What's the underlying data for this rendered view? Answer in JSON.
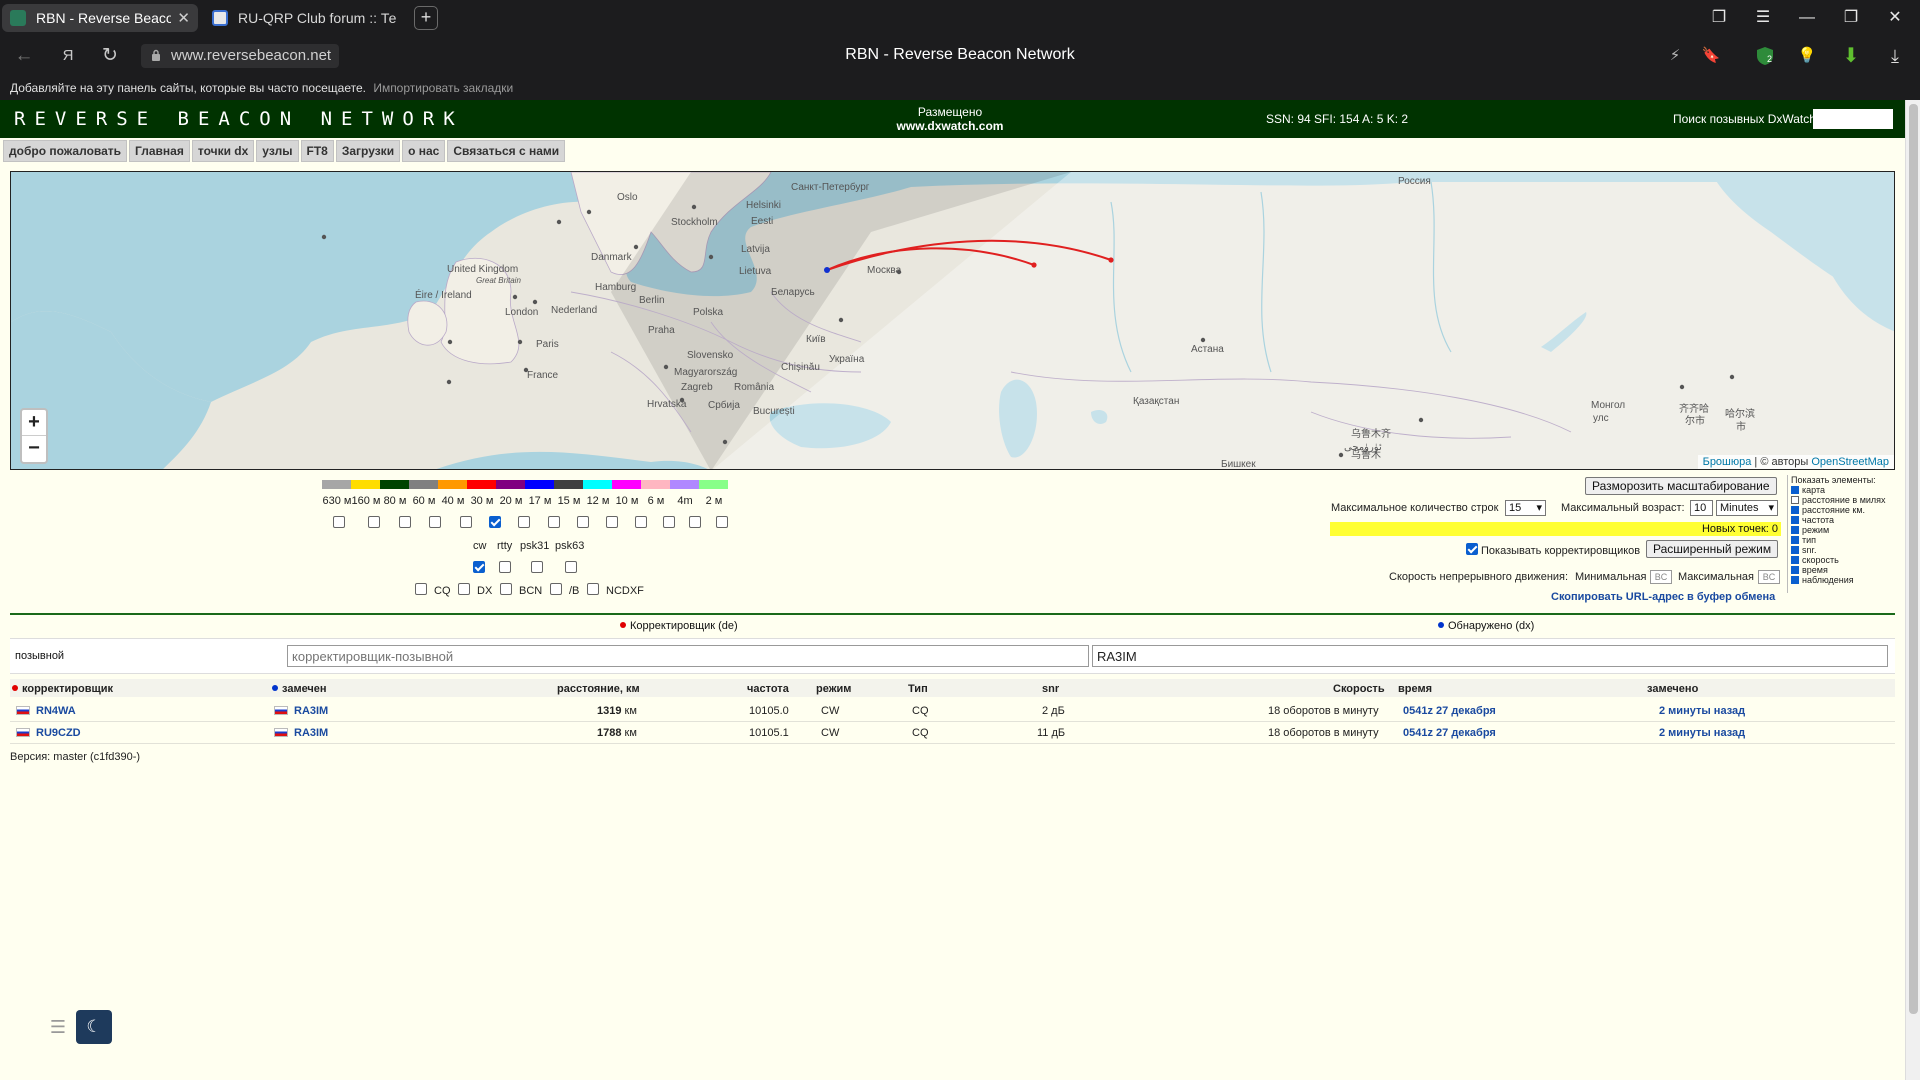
{
  "browser": {
    "tabs": [
      {
        "title": "RBN - Reverse Beacon N",
        "active": true
      },
      {
        "title": "RU-QRP Club forum :: Тема",
        "active": false
      }
    ],
    "url": "www.reversebeacon.net",
    "window_title": "RBN - Reverse Beacon Network",
    "bookmarks_hint": "Добавляйте на эту панель сайты, которые вы часто посещаете.",
    "import_bookmarks": "Импортировать закладки",
    "extension_badge": "2"
  },
  "site": {
    "logo": "REVERSE BEACON NETWORK",
    "sponsor_line1": "Размещено",
    "sponsor_line2": "www.dxwatch.com",
    "solar": "SSN: 94 SFI: 154 A: 5 K: 2",
    "dx_search_label": "Поиск позывных DxWatch:"
  },
  "menu": [
    "добро пожаловать",
    "Главная",
    "точки dx",
    "узлы",
    "FT8",
    "Загрузки",
    "о нас",
    "Связаться с нами"
  ],
  "map": {
    "labels": [
      {
        "t": "Oslo"
      },
      {
        "t": "Stockholm"
      },
      {
        "t": "Helsinki"
      },
      {
        "t": "Санкт-Петербург"
      },
      {
        "t": "Eesti"
      },
      {
        "t": "Latvija"
      },
      {
        "t": "Lietuva"
      },
      {
        "t": "Danmark"
      },
      {
        "t": "United Kingdom"
      },
      {
        "t": "Great Britain"
      },
      {
        "t": "Éire / Ireland"
      },
      {
        "t": "Hamburg"
      },
      {
        "t": "Berlin"
      },
      {
        "t": "Nederland"
      },
      {
        "t": "London"
      },
      {
        "t": "Polska"
      },
      {
        "t": "Москва"
      },
      {
        "t": "Беларусь"
      },
      {
        "t": "Praha"
      },
      {
        "t": "Paris"
      },
      {
        "t": "Київ"
      },
      {
        "t": "Україна"
      },
      {
        "t": "Slovensko"
      },
      {
        "t": "Magyarország"
      },
      {
        "t": "France"
      },
      {
        "t": "Chișinău"
      },
      {
        "t": "Zagreb"
      },
      {
        "t": "România"
      },
      {
        "t": "Hrvatska"
      },
      {
        "t": "Србија"
      },
      {
        "t": "București"
      },
      {
        "t": "Россия"
      },
      {
        "t": "Астана"
      },
      {
        "t": "Қазақстан"
      },
      {
        "t": "Монгол"
      },
      {
        "t": "улс"
      },
      {
        "t": "Бишкек"
      },
      {
        "t": "乌鲁木齐"
      },
      {
        "t": "ئۈرۈمچى"
      },
      {
        "t": "乌鲁木"
      },
      {
        "t": "齐齐哈"
      },
      {
        "t": "尔市"
      },
      {
        "t": "哈尔滨"
      },
      {
        "t": "市"
      }
    ],
    "attribution_prefix": "Брошюра",
    "attribution_mid": "| © авторы",
    "attribution_link": "OpenStreetMap",
    "zoom_in": "+",
    "zoom_out": "−"
  },
  "bands": [
    {
      "label": "630 м",
      "color": "#a6a6a6",
      "checked": false
    },
    {
      "label": "160 м",
      "color": "#ffdd00",
      "checked": false
    },
    {
      "label": "80 м",
      "color": "#004400",
      "checked": false
    },
    {
      "label": "60 м",
      "color": "#808080",
      "checked": false
    },
    {
      "label": "40 м",
      "color": "#ff9900",
      "checked": false
    },
    {
      "label": "30 м",
      "color": "#ff0000",
      "checked": true
    },
    {
      "label": "20 м",
      "color": "#800080",
      "checked": false
    },
    {
      "label": "17 м",
      "color": "#0000ff",
      "checked": false
    },
    {
      "label": "15 м",
      "color": "#404040",
      "checked": false
    },
    {
      "label": "12 м",
      "color": "#00ffff",
      "checked": false
    },
    {
      "label": "10 м",
      "color": "#ff00ff",
      "checked": false
    },
    {
      "label": "6 м",
      "color": "#ffb6c1",
      "checked": false
    },
    {
      "label": "4m",
      "color": "#b088ff",
      "checked": false
    },
    {
      "label": "2 м",
      "color": "#88ff88",
      "checked": false
    }
  ],
  "modes": [
    {
      "label": "cw",
      "checked": true
    },
    {
      "label": "rtty",
      "checked": false
    },
    {
      "label": "psk31",
      "checked": false
    },
    {
      "label": "psk63",
      "checked": false
    }
  ],
  "types": [
    {
      "label": "CQ",
      "checked": false
    },
    {
      "label": "DX",
      "checked": false
    },
    {
      "label": "BCN",
      "checked": false
    },
    {
      "label": "/B",
      "checked": false
    },
    {
      "label": "NCDXF",
      "checked": false
    }
  ],
  "controls": {
    "unfreeze": "Разморозить масштабирование",
    "max_rows_label": "Максимальное количество строк",
    "max_rows_value": "15",
    "max_age_label": "Максимальный возраст:",
    "max_age_value": "10",
    "max_age_unit": "Minutes",
    "new_points": "Новых точек: 0",
    "show_correctors": "Показывать корректировщиков",
    "advanced_mode": "Расширенный режим",
    "speed_label": "Скорость непрерывного движения:",
    "min_label": "Минимальная",
    "max_label": "Максимальная",
    "bc": "BC",
    "copy_url": "Скопировать URL-адрес в буфер обмена"
  },
  "show_elements": {
    "title": "Показать элементы:",
    "items": [
      {
        "label": "карта",
        "checked": true
      },
      {
        "label": "расстояние в милях",
        "checked": false
      },
      {
        "label": "расстояние км.",
        "checked": true
      },
      {
        "label": "частота",
        "checked": true
      },
      {
        "label": "режим",
        "checked": true
      },
      {
        "label": "тип",
        "checked": true
      },
      {
        "label": "snr.",
        "checked": true
      },
      {
        "label": "скорость",
        "checked": true
      },
      {
        "label": "время",
        "checked": true
      },
      {
        "label": "наблюдения",
        "checked": true
      }
    ]
  },
  "search": {
    "spotter_header": "Корректировщик (de)",
    "dx_header": "Обнаружено (dx)",
    "callsign_label": "позывной",
    "spotter_placeholder": "корректировщик-позывной",
    "dx_value": "RA3IM"
  },
  "table": {
    "headers": {
      "spotter": "корректировщик",
      "spotted": "замечен",
      "distance": "расстояние, км",
      "freq": "частота",
      "mode": "режим",
      "type": "Тип",
      "snr": "snr",
      "speed": "Скорость",
      "time": "время",
      "seen": "замечено"
    },
    "rows": [
      {
        "spotter": "RN4WA",
        "dx": "RA3IM",
        "distance": "1319",
        "unit": "км",
        "freq": "10105.0",
        "mode": "CW",
        "type": "CQ",
        "snr": "2 дБ",
        "speed": "18 оборотов в минуту",
        "time": "0541z 27 декабря",
        "seen": "2 минуты назад"
      },
      {
        "spotter": "RU9CZD",
        "dx": "RA3IM",
        "distance": "1788",
        "unit": "км",
        "freq": "10105.1",
        "mode": "CW",
        "type": "CQ",
        "snr": "11 дБ",
        "speed": "18 оборотов в минуту",
        "time": "0541z 27 декабря",
        "seen": "2 минуты назад"
      }
    ]
  },
  "version": "Версия: master (c1fd390-)"
}
